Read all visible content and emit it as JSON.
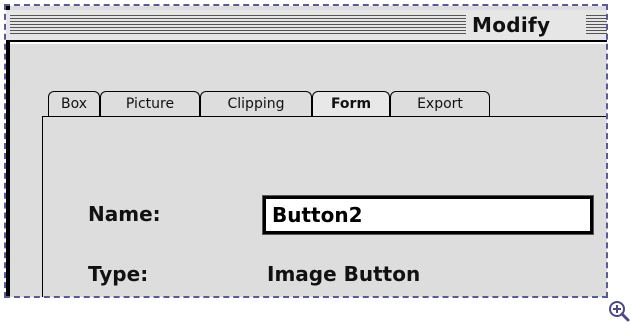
{
  "window": {
    "title": "Modify"
  },
  "tabs": [
    {
      "label": "Box",
      "active": false
    },
    {
      "label": "Picture",
      "active": false
    },
    {
      "label": "Clipping",
      "active": false
    },
    {
      "label": "Form",
      "active": true
    },
    {
      "label": "Export",
      "active": false
    }
  ],
  "form": {
    "name_label": "Name:",
    "name_value": "Button2",
    "type_label": "Type:",
    "type_value": "Image Button"
  },
  "icons": {
    "zoom": "zoom-in-icon"
  }
}
